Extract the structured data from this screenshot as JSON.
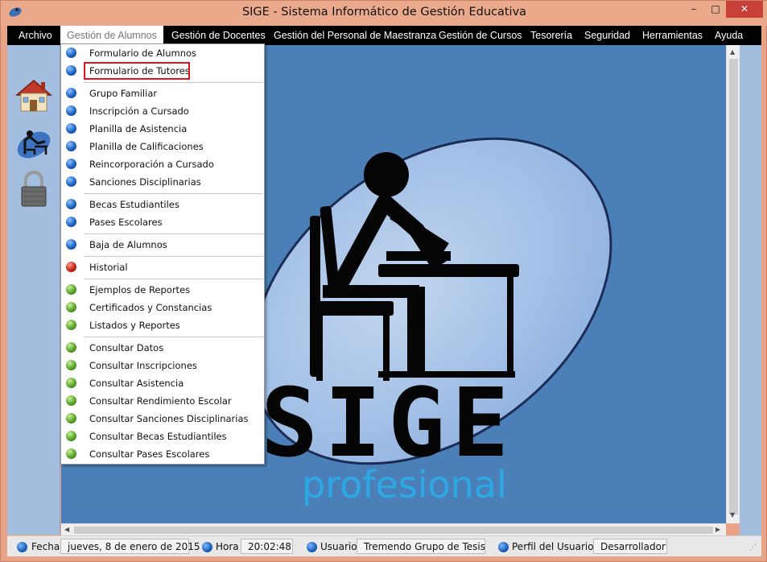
{
  "window": {
    "title": "SIGE - Sistema Informático de Gestión Educativa",
    "minimize": "–",
    "maximize": "□",
    "close": "✕"
  },
  "menubar": [
    "Archivo",
    "Gestión de Alumnos",
    "Gestión de Docentes",
    "Gestión del Personal de Maestranza",
    "Gestión de Cursos",
    "Tesorería",
    "Seguridad",
    "Herramientas",
    "Ayuda"
  ],
  "dropdown": {
    "items": [
      {
        "label": "Formulario de Alumnos",
        "bullet": "blue"
      },
      {
        "label": "Formulario de Tutores",
        "bullet": "blue",
        "highlighted": true
      },
      {
        "label": "Grupo Familiar",
        "bullet": "blue"
      },
      {
        "label": "Inscripción a Cursado",
        "bullet": "blue"
      },
      {
        "label": "Planilla de Asistencia",
        "bullet": "blue"
      },
      {
        "label": "Planilla de Calificaciones",
        "bullet": "blue"
      },
      {
        "label": "Reincorporación a Cursado",
        "bullet": "blue"
      },
      {
        "label": "Sanciones Disciplinarias",
        "bullet": "blue"
      },
      {
        "label": "Becas Estudiantiles",
        "bullet": "blue"
      },
      {
        "label": "Pases Escolares",
        "bullet": "blue"
      },
      {
        "label": "Baja de Alumnos",
        "bullet": "blue"
      },
      {
        "label": "Historial",
        "bullet": "red"
      },
      {
        "label": "Ejemplos de Reportes",
        "bullet": "green"
      },
      {
        "label": "Certificados y Constancias",
        "bullet": "green"
      },
      {
        "label": "Listados y Reportes",
        "bullet": "green"
      },
      {
        "label": "Consultar Datos",
        "bullet": "green"
      },
      {
        "label": "Consultar Inscripciones",
        "bullet": "green"
      },
      {
        "label": "Consultar Asistencia",
        "bullet": "green"
      },
      {
        "label": "Consultar Rendimiento Escolar",
        "bullet": "green"
      },
      {
        "label": "Consultar Sanciones Disciplinarias",
        "bullet": "green"
      },
      {
        "label": "Consultar Becas Estudiantiles",
        "bullet": "green"
      },
      {
        "label": "Consultar Pases Escolares",
        "bullet": "green"
      }
    ]
  },
  "sidebar": {
    "icons": [
      "house-icon",
      "student-desk-icon",
      "padlock-icon"
    ]
  },
  "logo": {
    "word": "SIGE",
    "subtitle": "profesional"
  },
  "statusbar": {
    "fecha_label": "Fecha",
    "fecha_value": "jueves, 8 de enero de 2015",
    "hora_label": "Hora",
    "hora_value": "20:02:48",
    "usuario_label": "Usuario",
    "usuario_value": "Tremendo Grupo de Tesis",
    "perfil_label": "Perfil del Usuario",
    "perfil_value": "Desarrollador"
  },
  "colors": {
    "menubar_bg": "#000000",
    "main_bg": "#4a80b7",
    "sidebar_bg": "#a4bee0",
    "titlebar_bg": "#eba98c",
    "highlight_border": "#e0141b",
    "subtitle_color": "#2ea8e4"
  }
}
